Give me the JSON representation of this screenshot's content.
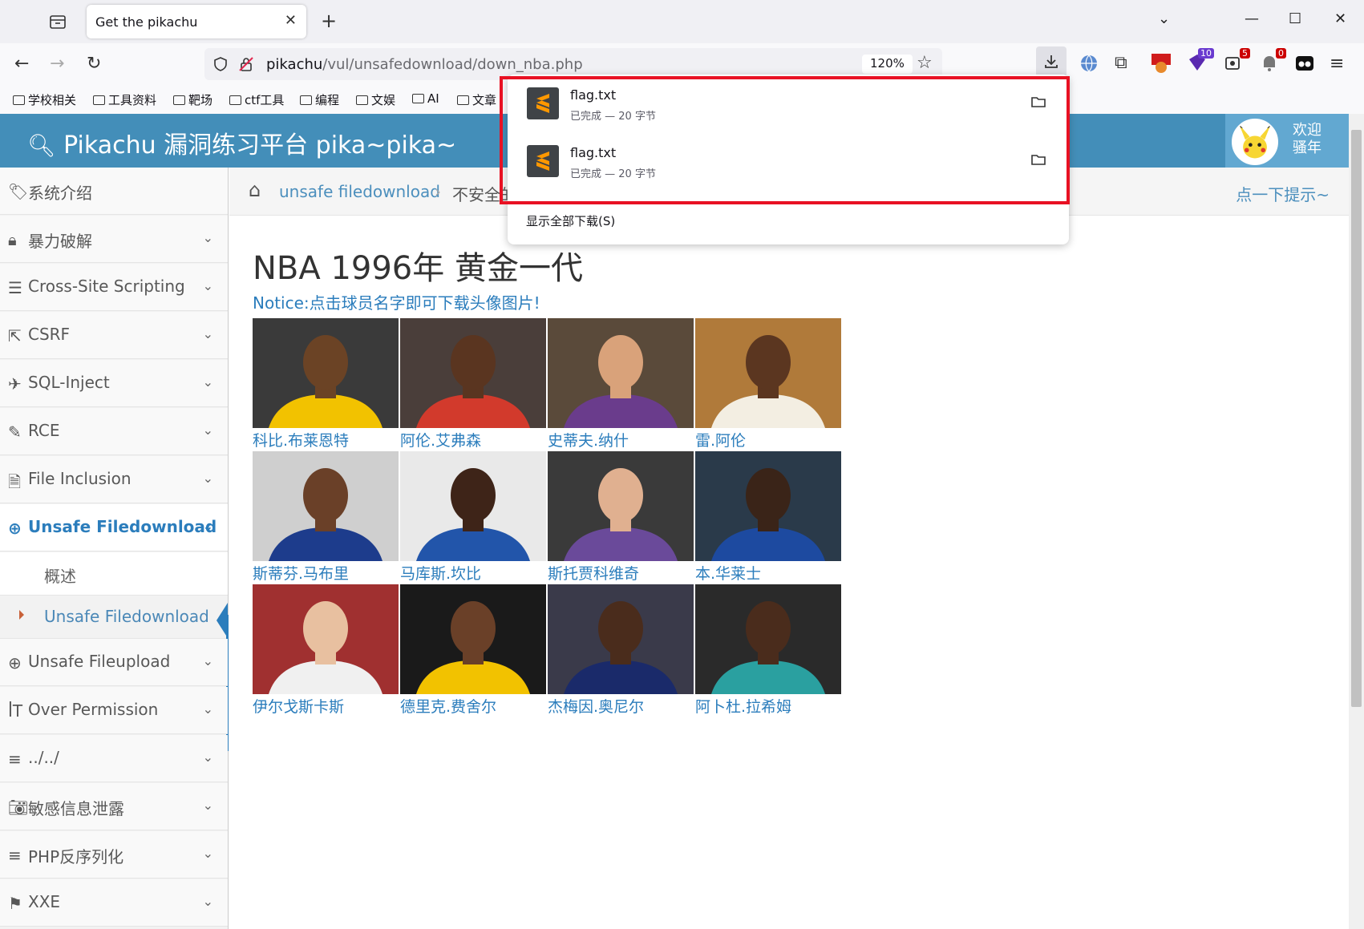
{
  "browser": {
    "tab_title": "Get the pikachu",
    "url_host": "pikachu",
    "url_path": "/vul/unsafedownload/down_nba.php",
    "zoom": "120%",
    "extension_badges": [
      "10",
      "5",
      "0"
    ],
    "bookmarks": [
      "学校相关",
      "工具资料",
      "靶场",
      "ctf工具",
      "编程",
      "文娱",
      "AI",
      "文章"
    ]
  },
  "downloads": {
    "items": [
      {
        "name": "flag.txt",
        "status": "已完成 — 20 字节"
      },
      {
        "name": "flag.txt",
        "status": "已完成 — 20 字节"
      }
    ],
    "show_all": "显示全部下载(S)"
  },
  "header": {
    "brand": "Pikachu 漏洞练习平台 pika~pika~",
    "welcome": "欢迎 骚年"
  },
  "sidebar": {
    "items": [
      {
        "icon": "tag-icon",
        "label": "系统介绍"
      },
      {
        "icon": "lock-icon",
        "label": "暴力破解"
      },
      {
        "icon": "list-icon",
        "label": "Cross-Site Scripting"
      },
      {
        "icon": "share-icon",
        "label": "CSRF"
      },
      {
        "icon": "plane-icon",
        "label": "SQL-Inject"
      },
      {
        "icon": "pencil-icon",
        "label": "RCE"
      },
      {
        "icon": "file-icon",
        "label": "File Inclusion"
      },
      {
        "icon": "download-icon",
        "label": "Unsafe Filedownload"
      },
      {
        "icon": "upload-icon",
        "label": "Unsafe Fileupload"
      },
      {
        "icon": "text-height-icon",
        "label": "Over Permission"
      },
      {
        "icon": "align-left-icon",
        "label": "../../"
      },
      {
        "icon": "camera-icon",
        "label": "敏感信息泄露"
      },
      {
        "icon": "align-left-icon",
        "label": "PHP反序列化"
      },
      {
        "icon": "flag-icon",
        "label": "XXE"
      }
    ],
    "subitems": [
      "概述",
      "Unsafe Filedownload"
    ]
  },
  "breadcrumb": {
    "link": "unsafe filedownload",
    "current": "不安全的文件下载",
    "hint": "点一下提示~"
  },
  "main": {
    "title": "NBA 1996年 黄金一代",
    "notice": "Notice:点击球员名字即可下载头像图片!",
    "players": [
      {
        "name": "科比.布莱恩特",
        "bg": "#3a3a3a",
        "jersey": "#f2c200",
        "skin": "#6b4325"
      },
      {
        "name": "阿伦.艾弗森",
        "bg": "#4a3e3a",
        "jersey": "#d23a2c",
        "skin": "#5a3520"
      },
      {
        "name": "史蒂夫.纳什",
        "bg": "#5a4a3a",
        "jersey": "#6a3c8c",
        "skin": "#d9a27a"
      },
      {
        "name": "雷.阿伦",
        "bg": "#b07a3a",
        "jersey": "#f3eee2",
        "skin": "#5b3620"
      },
      {
        "name": "斯蒂芬.马布里",
        "bg": "#cfcfcf",
        "jersey": "#1d3c8c",
        "skin": "#6a4028"
      },
      {
        "name": "马库斯.坎比",
        "bg": "#e9e9e9",
        "jersey": "#2255aa",
        "skin": "#3e2418"
      },
      {
        "name": "斯托贾科维奇",
        "bg": "#3a3a3a",
        "jersey": "#6a4a9a",
        "skin": "#e0b090"
      },
      {
        "name": "本.华莱士",
        "bg": "#2a3a4a",
        "jersey": "#1d4aa0",
        "skin": "#3a2418"
      },
      {
        "name": "伊尔戈斯卡斯",
        "bg": "#a03030",
        "jersey": "#f0f0f0",
        "skin": "#e8c0a0"
      },
      {
        "name": "德里克.费舍尔",
        "bg": "#1a1a1a",
        "jersey": "#f2c200",
        "skin": "#6a4028"
      },
      {
        "name": "杰梅因.奥尼尔",
        "bg": "#3a3a4a",
        "jersey": "#1a2a6a",
        "skin": "#4a2c1c"
      },
      {
        "name": "阿卜杜.拉希姆",
        "bg": "#2a2a2a",
        "jersey": "#2aa0a0",
        "skin": "#4a2c1c"
      }
    ]
  }
}
